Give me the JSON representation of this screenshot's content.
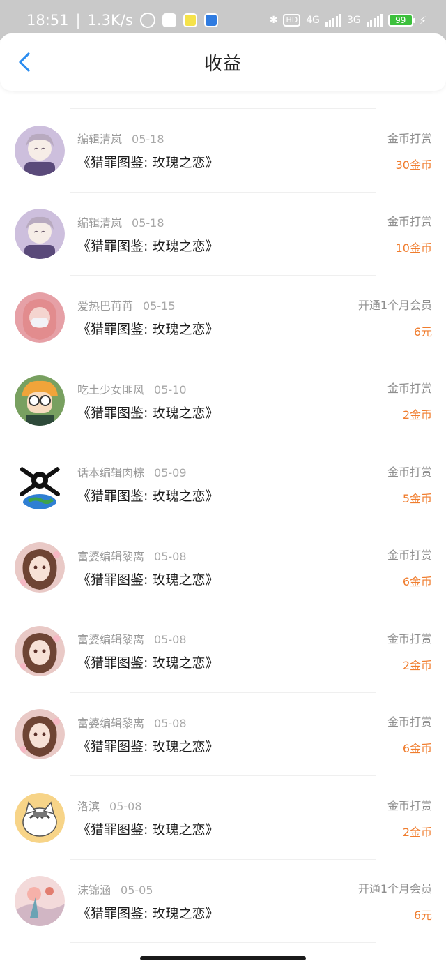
{
  "statusbar": {
    "time": "18:51",
    "speed": "1.3K/s",
    "net1": "4G",
    "net2": "3G",
    "hd": "HD",
    "battery": "99"
  },
  "header": {
    "title": "收益"
  },
  "colors": {
    "accent": "#f07d2e",
    "back": "#2a8cf0"
  },
  "rows": [
    {
      "name": "编辑清岚",
      "date": "05-18",
      "book": "《猎罪图鉴: 玫瑰之恋》",
      "type": "金币打赏",
      "amount": "30金币",
      "avatar": "anime-girl-lilac"
    },
    {
      "name": "编辑清岚",
      "date": "05-18",
      "book": "《猎罪图鉴: 玫瑰之恋》",
      "type": "金币打赏",
      "amount": "10金币",
      "avatar": "anime-girl-lilac"
    },
    {
      "name": "爱热巴苒苒",
      "date": "05-15",
      "book": "《猎罪图鉴: 玫瑰之恋》",
      "type": "开通1个月会员",
      "amount": "6元",
      "avatar": "girl-pink-mask"
    },
    {
      "name": "吃土少女匪风",
      "date": "05-10",
      "book": "《猎罪图鉴: 玫瑰之恋》",
      "type": "金币打赏",
      "amount": "2金币",
      "avatar": "cartoon-glasses"
    },
    {
      "name": "话本编辑肉粽",
      "date": "05-09",
      "book": "《猎罪图鉴: 玫瑰之恋》",
      "type": "金币打赏",
      "amount": "5金币",
      "avatar": "skull-earth"
    },
    {
      "name": "富婆编辑黎离",
      "date": "05-08",
      "book": "《猎罪图鉴: 玫瑰之恋》",
      "type": "金币打赏",
      "amount": "6金币",
      "avatar": "anime-girl-brown"
    },
    {
      "name": "富婆编辑黎离",
      "date": "05-08",
      "book": "《猎罪图鉴: 玫瑰之恋》",
      "type": "金币打赏",
      "amount": "2金币",
      "avatar": "anime-girl-brown"
    },
    {
      "name": "富婆编辑黎离",
      "date": "05-08",
      "book": "《猎罪图鉴: 玫瑰之恋》",
      "type": "金币打赏",
      "amount": "6金币",
      "avatar": "anime-girl-brown"
    },
    {
      "name": "洛滨",
      "date": "05-08",
      "book": "《猎罪图鉴: 玫瑰之恋》",
      "type": "金币打赏",
      "amount": "2金币",
      "avatar": "cartoon-cat"
    },
    {
      "name": "沫锦涵",
      "date": "05-05",
      "book": "《猎罪图鉴: 玫瑰之恋》",
      "type": "开通1个月会员",
      "amount": "6元",
      "avatar": "pink-scenery"
    }
  ]
}
